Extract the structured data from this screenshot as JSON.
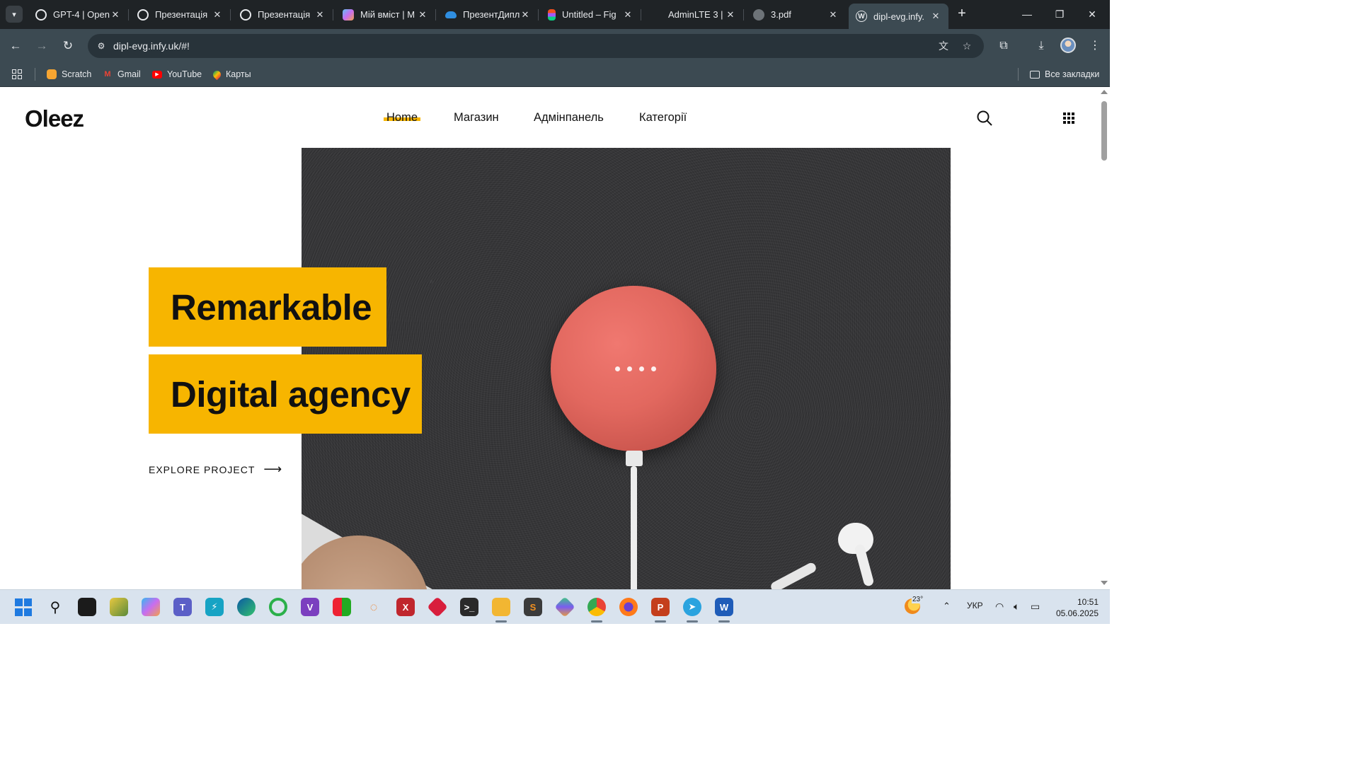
{
  "browser": {
    "tabs": [
      {
        "title": "GPT-4 | OpenAI",
        "icon": "openai-icon"
      },
      {
        "title": "Презентація",
        "icon": "openai-icon"
      },
      {
        "title": "Презентація",
        "icon": "openai-icon"
      },
      {
        "title": "Мій вміст | M",
        "icon": "copilot-icon"
      },
      {
        "title": "ПрезентДипл",
        "icon": "onedrive-icon"
      },
      {
        "title": "Untitled – Fig",
        "icon": "figma-icon"
      },
      {
        "title": "AdminLTE 3 |",
        "icon": "blank-icon"
      },
      {
        "title": "3.pdf",
        "icon": "globe-icon"
      },
      {
        "title": "dipl-evg.infy.",
        "icon": "wordpress-icon"
      }
    ],
    "url": "dipl-evg.infy.uk/#!",
    "bookmarks": [
      {
        "label": "Scratch",
        "icon": "scratch-icon"
      },
      {
        "label": "Gmail",
        "icon": "gmail-icon"
      },
      {
        "label": "YouTube",
        "icon": "youtube-icon"
      },
      {
        "label": "Карты",
        "icon": "maps-icon"
      }
    ],
    "all_bookmarks": "Все закладки"
  },
  "site": {
    "logo": "Oleez",
    "nav": [
      "Home",
      "Магазин",
      "Адмінпанель",
      "Категорії"
    ],
    "hero_line1": "Remarkable",
    "hero_line2": "Digital agency",
    "cta": "EXPLORE PROJECT",
    "cta_arrow": "⟶",
    "accent": "#f7b500"
  },
  "taskbar": {
    "weather_temp": "23°",
    "language": "УКР",
    "time": "10:51",
    "date": "05.06.2025"
  }
}
